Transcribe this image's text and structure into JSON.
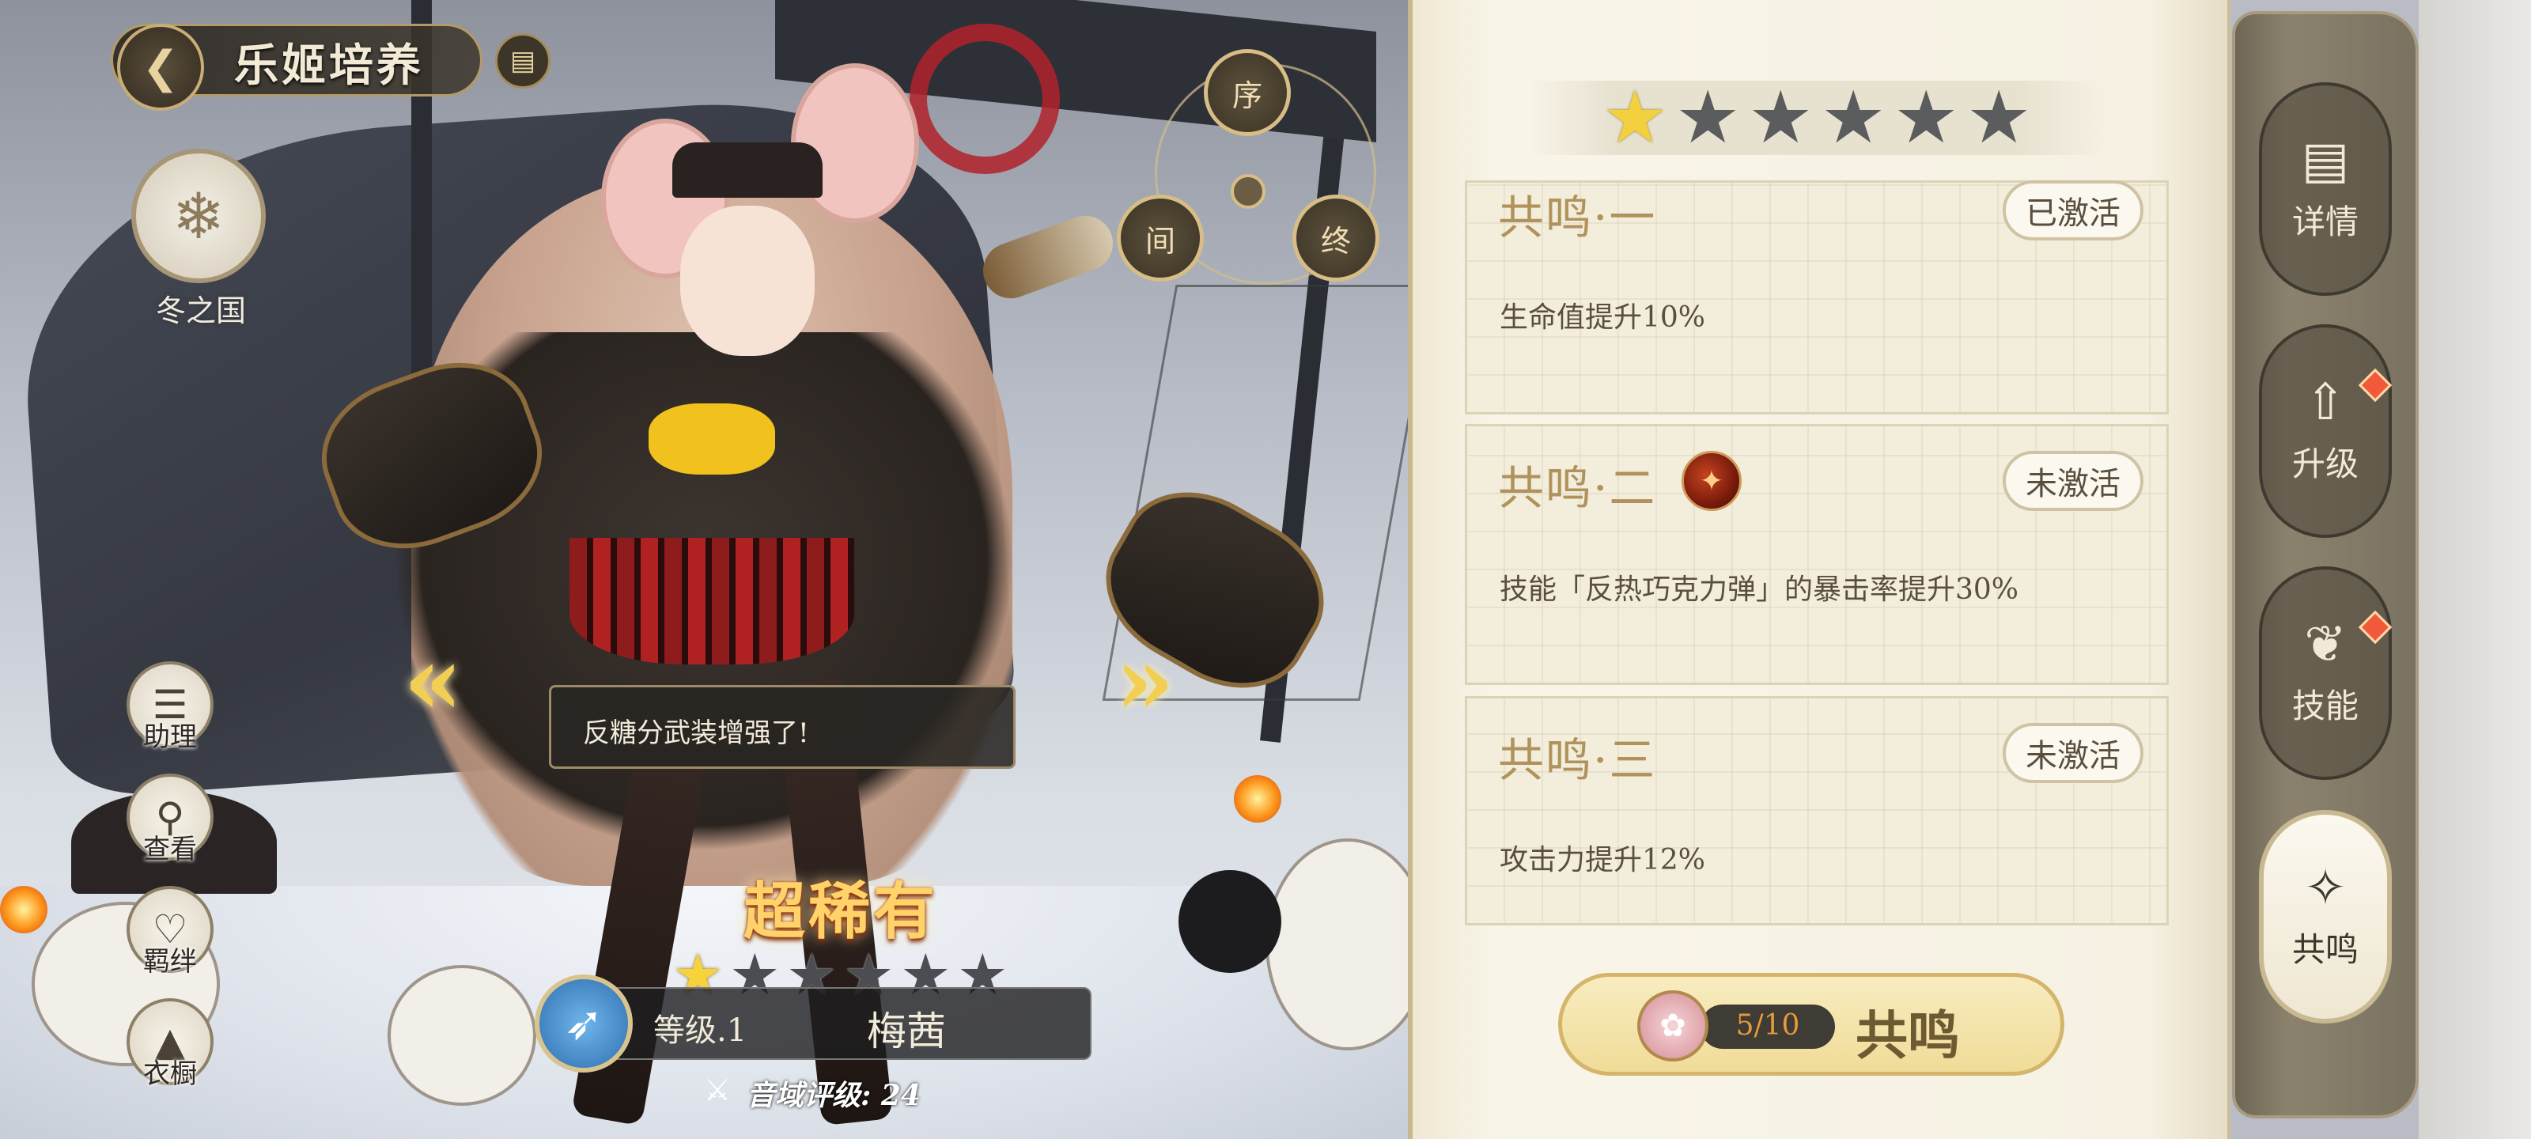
{
  "header": {
    "title": "乐姬培养",
    "back_icon": "back-arrow-icon",
    "archive_icon": "archive-icon"
  },
  "nation": {
    "label": "冬之国",
    "icon": "snowflake-emblem-icon"
  },
  "order_wheel": {
    "top": "序",
    "left": "间",
    "right": "终"
  },
  "side_menu": [
    {
      "label": "助理",
      "icon": "assistant-icon"
    },
    {
      "label": "查看",
      "icon": "magnifier-icon"
    },
    {
      "label": "羁绊",
      "icon": "heart-bond-icon"
    },
    {
      "label": "衣橱",
      "icon": "wardrobe-icon"
    }
  ],
  "dialog": {
    "text": "反糖分武装增强了!"
  },
  "character": {
    "rarity": "超稀有",
    "level": "等级.1",
    "name": "梅茜",
    "stars_total": 6,
    "stars_filled": 1,
    "sound_rank": "音域评级: 24",
    "class_icon": "bow-class-icon"
  },
  "resonance_panel": {
    "stars_total": 6,
    "stars_filled": 1,
    "cards": [
      {
        "title": "共鸣·一",
        "status": "已激活",
        "desc": "生命值提升10%"
      },
      {
        "title": "共鸣·二",
        "status": "未激活",
        "desc": "技能「反热巧克力弹」的暴击率提升30%"
      },
      {
        "title": "共鸣·三",
        "status": "未激活",
        "desc": "攻击力提升12%"
      }
    ],
    "button": {
      "count": "5/10",
      "label": "共鸣"
    }
  },
  "nav_rail": [
    {
      "label": "详情",
      "icon": "document-icon",
      "alert": false,
      "active": false
    },
    {
      "label": "升级",
      "icon": "upgrade-arrow-icon",
      "alert": true,
      "active": false
    },
    {
      "label": "技能",
      "icon": "skill-wings-icon",
      "alert": true,
      "active": false
    },
    {
      "label": "共鸣",
      "icon": "resonance-star-icon",
      "alert": false,
      "active": true
    }
  ],
  "colors": {
    "panel_bg": "#f6f1e3",
    "gold_title": "#b0935b",
    "star_on": "#f3d13e",
    "alert": "#f05a3a"
  }
}
